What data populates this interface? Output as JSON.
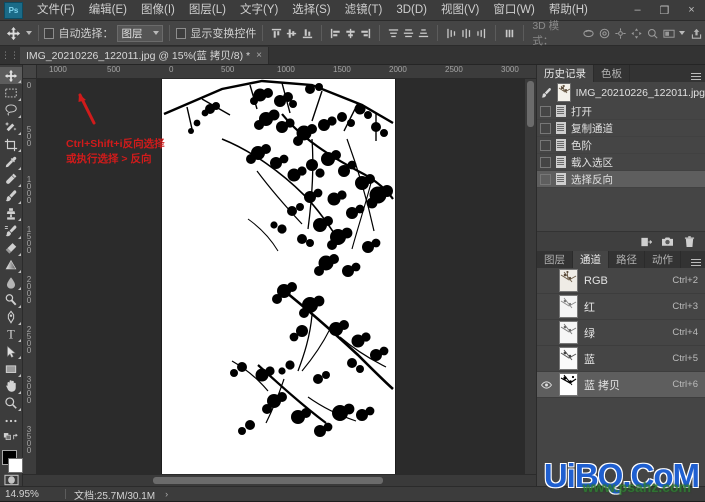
{
  "app": {
    "logo": "Ps",
    "window_controls": [
      {
        "name": "minimize",
        "glyph": "–"
      },
      {
        "name": "restore",
        "glyph": "❐"
      },
      {
        "name": "close",
        "glyph": "×"
      }
    ]
  },
  "menubar": {
    "items": [
      {
        "label": "文件(F)"
      },
      {
        "label": "编辑(E)"
      },
      {
        "label": "图像(I)"
      },
      {
        "label": "图层(L)"
      },
      {
        "label": "文字(Y)"
      },
      {
        "label": "选择(S)"
      },
      {
        "label": "滤镜(T)"
      },
      {
        "label": "3D(D)"
      },
      {
        "label": "视图(V)"
      },
      {
        "label": "窗口(W)"
      },
      {
        "label": "帮助(H)"
      }
    ]
  },
  "options_bar": {
    "auto_select_label": "自动选择：",
    "auto_select_value": "图层",
    "show_transform_label": "显示变换控件",
    "mode_3d_label": "3D 模式："
  },
  "tabs": {
    "document_title": "IMG_20210226_122011.jpg @ 15%(蓝 拷贝/8) *",
    "close_glyph": "×"
  },
  "toolbox": {
    "tools": [
      {
        "name": "move-tool",
        "selected": true
      },
      {
        "name": "rectangular-marquee-tool",
        "selected": false
      },
      {
        "name": "lasso-tool",
        "selected": false
      },
      {
        "name": "quick-selection-tool",
        "selected": false
      },
      {
        "name": "crop-tool",
        "selected": false
      },
      {
        "name": "eyedropper-tool",
        "selected": false
      },
      {
        "name": "healing-brush-tool",
        "selected": false
      },
      {
        "name": "brush-tool",
        "selected": false
      },
      {
        "name": "clone-stamp-tool",
        "selected": false
      },
      {
        "name": "history-brush-tool",
        "selected": false
      },
      {
        "name": "eraser-tool",
        "selected": false
      },
      {
        "name": "gradient-tool",
        "selected": false
      },
      {
        "name": "blur-tool",
        "selected": false
      },
      {
        "name": "dodge-tool",
        "selected": false
      },
      {
        "name": "pen-tool",
        "selected": false
      },
      {
        "name": "type-tool",
        "selected": false
      },
      {
        "name": "path-selection-tool",
        "selected": false
      },
      {
        "name": "rectangle-tool",
        "selected": false
      },
      {
        "name": "hand-tool",
        "selected": false
      },
      {
        "name": "zoom-tool",
        "selected": false
      },
      {
        "name": "edit-toolbar-tool",
        "selected": false
      }
    ],
    "foreground_color": "#000000",
    "background_color": "#ffffff"
  },
  "rulers": {
    "horizontal": [
      "1000",
      "500",
      "0",
      "500",
      "1000",
      "1500",
      "2000",
      "2500",
      "3000"
    ],
    "vertical": [
      "0",
      "500",
      "1000",
      "1500",
      "2000",
      "2500",
      "3000",
      "3500"
    ],
    "unit": "px"
  },
  "canvas": {
    "annotation_line1": "Ctrl+Shift+i反向选择",
    "annotation_line2": "或执行选择 > 反向",
    "annotation_color": "#d01b1b"
  },
  "history_panel": {
    "tabs": [
      {
        "label": "历史记录",
        "active": true
      },
      {
        "label": "色板",
        "active": false
      }
    ],
    "source_name": "IMG_20210226_122011.jpg",
    "states": [
      {
        "label": "打开",
        "active": false
      },
      {
        "label": "复制通道",
        "active": false
      },
      {
        "label": "色阶",
        "active": false
      },
      {
        "label": "载入选区",
        "active": false
      },
      {
        "label": "选择反向",
        "active": true
      }
    ],
    "footer_icons": [
      "new-document-from-state-icon",
      "new-snapshot-icon",
      "delete-state-icon"
    ]
  },
  "channels_panel": {
    "tabs": [
      {
        "label": "图层",
        "active": false
      },
      {
        "label": "通道",
        "active": true
      },
      {
        "label": "路径",
        "active": false
      },
      {
        "label": "动作",
        "active": false
      }
    ],
    "channels": [
      {
        "name": "RGB",
        "shortcut": "Ctrl+2",
        "visible": false,
        "active": false
      },
      {
        "name": "红",
        "shortcut": "Ctrl+3",
        "visible": false,
        "active": false
      },
      {
        "name": "绿",
        "shortcut": "Ctrl+4",
        "visible": false,
        "active": false
      },
      {
        "name": "蓝",
        "shortcut": "Ctrl+5",
        "visible": false,
        "active": false
      },
      {
        "name": "蓝 拷贝",
        "shortcut": "Ctrl+6",
        "visible": true,
        "active": true
      }
    ]
  },
  "status_bar": {
    "zoom": "14.95%",
    "doc_info": "文档:25.7M/30.1M",
    "expand_glyph": "›"
  },
  "watermark": {
    "main": "UiBQ.CoM",
    "sub": "www.psahz.com"
  }
}
